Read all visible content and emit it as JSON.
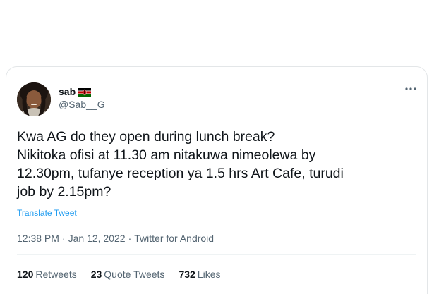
{
  "tweet": {
    "author_name": "sab",
    "author_flag": "kenya-flag-emoji",
    "handle": "@Sab__G",
    "text_lines": [
      "Kwa AG do they open during lunch break?",
      "Nikitoka ofisi at 11.30 am nitakuwa nimeolewa by",
      "12.30pm, tufanye reception ya 1.5 hrs Art Cafe, turudi",
      "job by 2.15pm?"
    ],
    "translate_label": "Translate Tweet",
    "time": "12:38 PM",
    "date": "Jan 12, 2022",
    "source": "Twitter for Android",
    "separator": "·",
    "more_icon": "more-horizontal-icon"
  },
  "stats": {
    "retweets_count": "120",
    "retweets_label": "Retweets",
    "quotes_count": "23",
    "quotes_label": "Quote Tweets",
    "likes_count": "732",
    "likes_label": "Likes"
  },
  "colors": {
    "text": "#0f1419",
    "secondary": "#536471",
    "link": "#1d9bf0",
    "border": "#e3e6e8"
  }
}
